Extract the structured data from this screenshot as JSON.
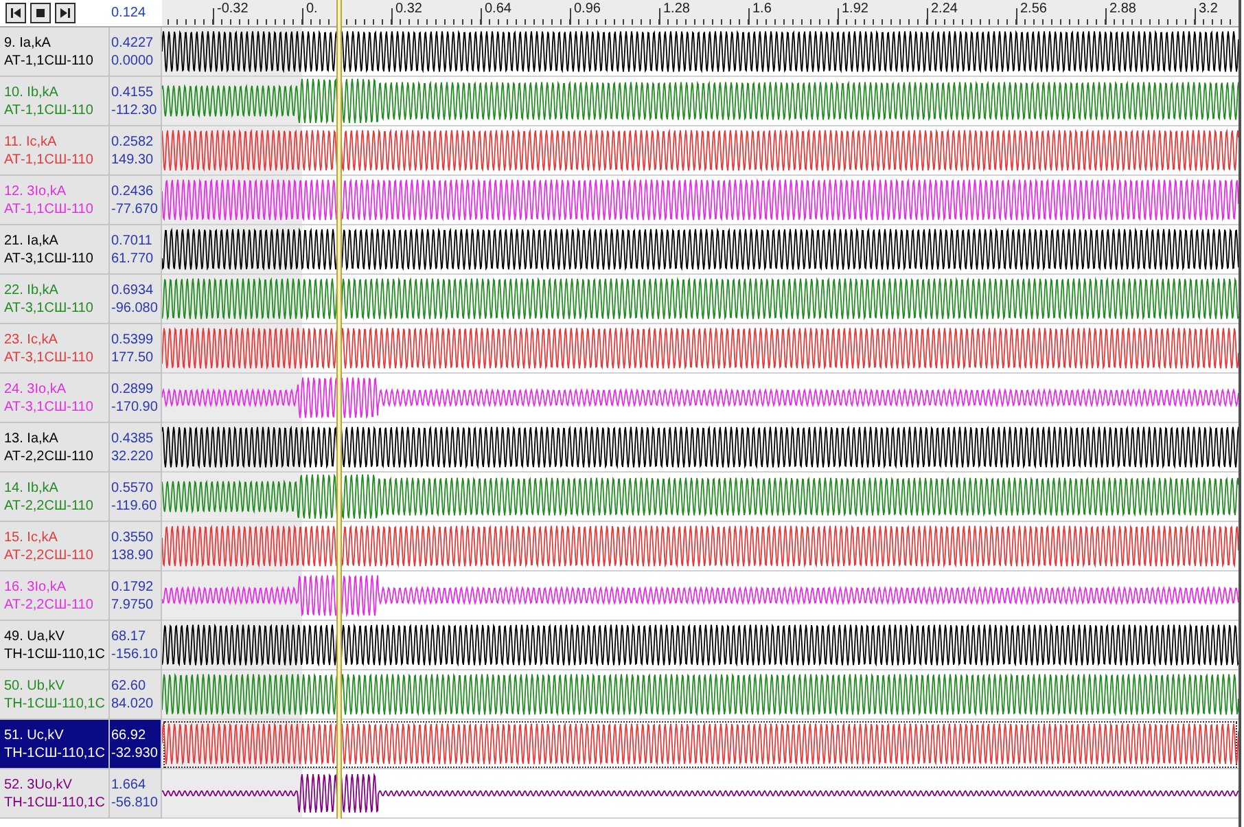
{
  "toolbar": {
    "cursor_time": "0.124"
  },
  "ruler": {
    "labels": [
      "-0.32",
      "0.",
      "0.32",
      "0.64",
      "0.96",
      "1.28",
      "1.6",
      "1.92",
      "2.24",
      "2.56",
      "2.88",
      "3.2"
    ]
  },
  "channels": [
    {
      "name": "9. Ia,kA",
      "source": "АТ-1,1СШ-110",
      "readings": [
        "0.4227",
        "0.0000"
      ],
      "color": "#000000",
      "kind": "steady",
      "selected": false
    },
    {
      "name": "10. Ib,kA",
      "source": "АТ-1,1СШ-110",
      "readings": [
        "0.4155",
        "-112.30"
      ],
      "color": "#228b22",
      "kind": "rise",
      "selected": false
    },
    {
      "name": "11. Ic,kA",
      "source": "АТ-1,1СШ-110",
      "readings": [
        "0.2582",
        "149.30"
      ],
      "color": "#e03c3c",
      "kind": "steady",
      "selected": false
    },
    {
      "name": "12. 3Io,kA",
      "source": "АТ-1,1СШ-110",
      "readings": [
        "0.2436",
        "-77.670"
      ],
      "color": "#e030e0",
      "kind": "steady",
      "selected": false
    },
    {
      "name": "21. Ia,kA",
      "source": "АТ-3,1СШ-110",
      "readings": [
        "0.7011",
        "61.770"
      ],
      "color": "#000000",
      "kind": "steady",
      "selected": false
    },
    {
      "name": "22. Ib,kA",
      "source": "АТ-3,1СШ-110",
      "readings": [
        "0.6934",
        "-96.080"
      ],
      "color": "#228b22",
      "kind": "steady",
      "selected": false
    },
    {
      "name": "23. Ic,kA",
      "source": "АТ-3,1СШ-110",
      "readings": [
        "0.5399",
        "177.50"
      ],
      "color": "#e03c3c",
      "kind": "steady",
      "selected": false
    },
    {
      "name": "24. 3Io,kA",
      "source": "АТ-3,1СШ-110",
      "readings": [
        "0.2899",
        "-170.90"
      ],
      "color": "#e030e0",
      "kind": "burst",
      "selected": false
    },
    {
      "name": "13. Ia,kA",
      "source": "АТ-2,2СШ-110",
      "readings": [
        "0.4385",
        "32.220"
      ],
      "color": "#000000",
      "kind": "steady",
      "selected": false
    },
    {
      "name": "14. Ib,kA",
      "source": "АТ-2,2СШ-110",
      "readings": [
        "0.5570",
        "-119.60"
      ],
      "color": "#228b22",
      "kind": "rise",
      "selected": false
    },
    {
      "name": "15. Ic,kA",
      "source": "АТ-2,2СШ-110",
      "readings": [
        "0.3550",
        "138.90"
      ],
      "color": "#e03c3c",
      "kind": "steady",
      "selected": false
    },
    {
      "name": "16. 3Io,kA",
      "source": "АТ-2,2СШ-110",
      "readings": [
        "0.1792",
        "7.9750"
      ],
      "color": "#e030e0",
      "kind": "burst",
      "selected": false
    },
    {
      "name": "49. Ua,kV",
      "source": "ТН-1СШ-110,1С",
      "readings": [
        "68.17",
        "-156.10"
      ],
      "color": "#000000",
      "kind": "steady",
      "selected": false
    },
    {
      "name": "50. Ub,kV",
      "source": "ТН-1СШ-110,1С",
      "readings": [
        "62.60",
        "84.020"
      ],
      "color": "#228b22",
      "kind": "steady",
      "selected": false
    },
    {
      "name": "51. Uc,kV",
      "source": "ТН-1СШ-110,1С",
      "readings": [
        "66.92",
        "-32.930"
      ],
      "color": "#e03c3c",
      "kind": "steady",
      "selected": true
    },
    {
      "name": "52. 3Uo,kV",
      "source": "ТН-1СШ-110,1С",
      "readings": [
        "1.664",
        "-56.810"
      ],
      "color": "#800080",
      "kind": "spike",
      "selected": false
    }
  ]
}
